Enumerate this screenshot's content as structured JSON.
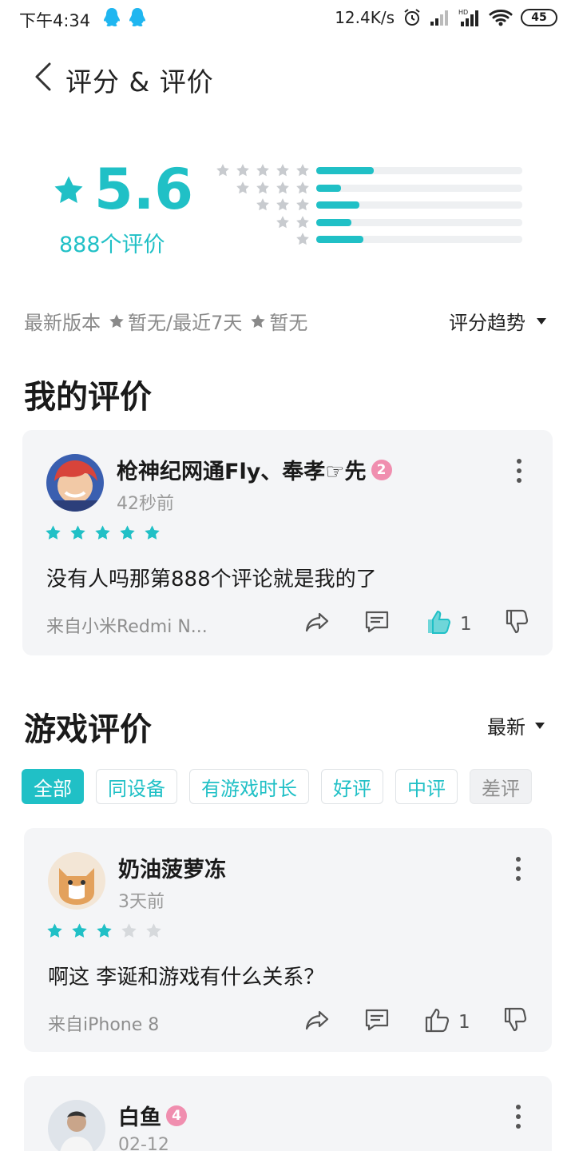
{
  "status_bar": {
    "time": "下午4:34",
    "net_speed": "12.4K/s",
    "battery": "45"
  },
  "header": {
    "title": "评分 & 评价"
  },
  "summary": {
    "score": "5.6",
    "count_label": "888个评价",
    "distribution": [
      {
        "stars": 5,
        "fraction": 0.28
      },
      {
        "stars": 4,
        "fraction": 0.12
      },
      {
        "stars": 3,
        "fraction": 0.21
      },
      {
        "stars": 2,
        "fraction": 0.17
      },
      {
        "stars": 1,
        "fraction": 0.23
      }
    ],
    "latest_version_label": "最新版本",
    "latest_version_value": "暂无",
    "separator": "/最近7天",
    "recent_value": "暂无",
    "trend_label": "评分趋势"
  },
  "my_review": {
    "section_title": "我的评价",
    "user": "枪神纪网通Fly、奉孝☞先",
    "level": "2",
    "time": "42秒前",
    "stars": 5,
    "text": "没有人吗那第888个评论就是我的了",
    "from": "来自小米Redmi N...",
    "likes": "1"
  },
  "game_reviews": {
    "section_title": "游戏评价",
    "sort_label": "最新",
    "filters": [
      "全部",
      "同设备",
      "有游戏时长",
      "好评",
      "中评",
      "差评"
    ],
    "items": [
      {
        "user": "奶油菠萝冻",
        "time": "3天前",
        "stars": 3,
        "text": "啊这 李诞和游戏有什么关系？",
        "from": "来自iPhone 8",
        "likes": "1"
      },
      {
        "user": "白鱼",
        "level": "4",
        "time": "02-12"
      }
    ]
  },
  "colors": {
    "accent": "#20c0c6",
    "star_empty": "#c8cbcf",
    "level_badge": "#f08eaf"
  }
}
